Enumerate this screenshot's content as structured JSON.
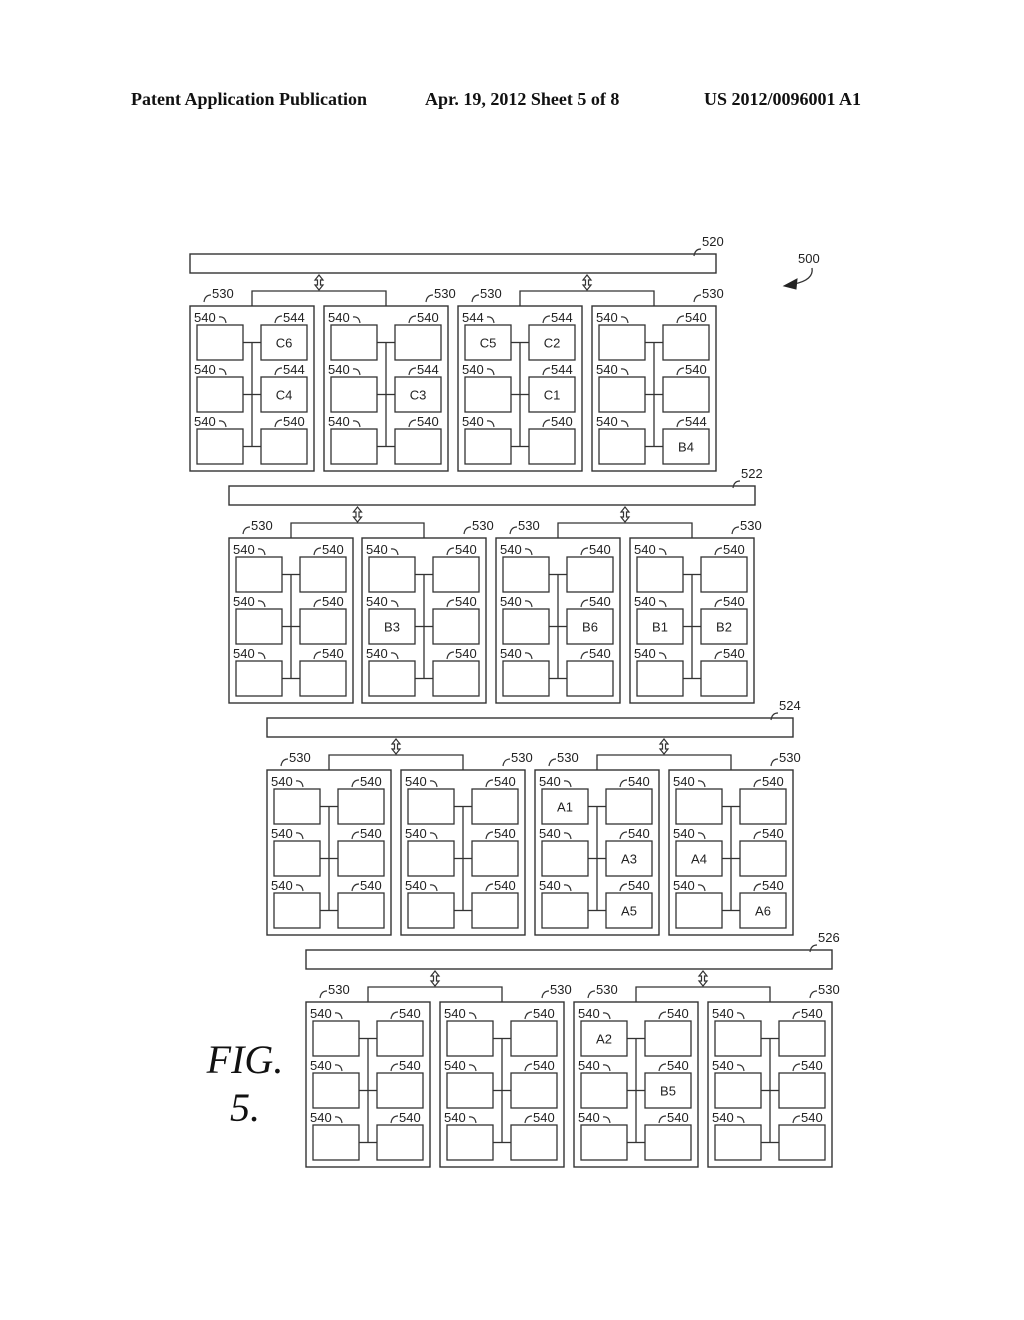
{
  "header": {
    "left": "Patent Application Publication",
    "center": "Apr. 19, 2012  Sheet 5 of 8",
    "right": "US 2012/0096001 A1"
  },
  "figure": {
    "line1": "FIG.",
    "line2": "5.",
    "system_ref": "500"
  },
  "tiers": [
    {
      "bar_ref": "520",
      "pod_ref": "530",
      "pods": [
        {
          "cells": [
            {
              "ref": "540",
              "text": ""
            },
            {
              "ref": "544",
              "text": "C6"
            },
            {
              "ref": "540",
              "text": ""
            },
            {
              "ref": "544",
              "text": "C4"
            },
            {
              "ref": "540",
              "text": ""
            },
            {
              "ref": "540",
              "text": ""
            }
          ]
        },
        {
          "cells": [
            {
              "ref": "540",
              "text": ""
            },
            {
              "ref": "540",
              "text": ""
            },
            {
              "ref": "540",
              "text": ""
            },
            {
              "ref": "544",
              "text": "C3"
            },
            {
              "ref": "540",
              "text": ""
            },
            {
              "ref": "540",
              "text": ""
            }
          ]
        },
        {
          "cells": [
            {
              "ref": "544",
              "text": "C5"
            },
            {
              "ref": "544",
              "text": "C2"
            },
            {
              "ref": "540",
              "text": ""
            },
            {
              "ref": "544",
              "text": "C1"
            },
            {
              "ref": "540",
              "text": ""
            },
            {
              "ref": "540",
              "text": ""
            }
          ]
        },
        {
          "cells": [
            {
              "ref": "540",
              "text": ""
            },
            {
              "ref": "540",
              "text": ""
            },
            {
              "ref": "540",
              "text": ""
            },
            {
              "ref": "540",
              "text": ""
            },
            {
              "ref": "540",
              "text": ""
            },
            {
              "ref": "544",
              "text": "B4"
            }
          ]
        }
      ]
    },
    {
      "bar_ref": "522",
      "pod_ref": "530",
      "pods": [
        {
          "cells": [
            {
              "ref": "540",
              "text": ""
            },
            {
              "ref": "540",
              "text": ""
            },
            {
              "ref": "540",
              "text": ""
            },
            {
              "ref": "540",
              "text": ""
            },
            {
              "ref": "540",
              "text": ""
            },
            {
              "ref": "540",
              "text": ""
            }
          ]
        },
        {
          "cells": [
            {
              "ref": "540",
              "text": ""
            },
            {
              "ref": "540",
              "text": ""
            },
            {
              "ref": "540",
              "text": "B3"
            },
            {
              "ref": "540",
              "text": ""
            },
            {
              "ref": "540",
              "text": ""
            },
            {
              "ref": "540",
              "text": ""
            }
          ]
        },
        {
          "cells": [
            {
              "ref": "540",
              "text": ""
            },
            {
              "ref": "540",
              "text": ""
            },
            {
              "ref": "540",
              "text": ""
            },
            {
              "ref": "540",
              "text": "B6"
            },
            {
              "ref": "540",
              "text": ""
            },
            {
              "ref": "540",
              "text": ""
            }
          ]
        },
        {
          "cells": [
            {
              "ref": "540",
              "text": ""
            },
            {
              "ref": "540",
              "text": ""
            },
            {
              "ref": "540",
              "text": "B1"
            },
            {
              "ref": "540",
              "text": "B2"
            },
            {
              "ref": "540",
              "text": ""
            },
            {
              "ref": "540",
              "text": ""
            }
          ]
        }
      ]
    },
    {
      "bar_ref": "524",
      "pod_ref": "530",
      "pods": [
        {
          "cells": [
            {
              "ref": "540",
              "text": ""
            },
            {
              "ref": "540",
              "text": ""
            },
            {
              "ref": "540",
              "text": ""
            },
            {
              "ref": "540",
              "text": ""
            },
            {
              "ref": "540",
              "text": ""
            },
            {
              "ref": "540",
              "text": ""
            }
          ]
        },
        {
          "cells": [
            {
              "ref": "540",
              "text": ""
            },
            {
              "ref": "540",
              "text": ""
            },
            {
              "ref": "540",
              "text": ""
            },
            {
              "ref": "540",
              "text": ""
            },
            {
              "ref": "540",
              "text": ""
            },
            {
              "ref": "540",
              "text": ""
            }
          ]
        },
        {
          "cells": [
            {
              "ref": "540",
              "text": "A1"
            },
            {
              "ref": "540",
              "text": ""
            },
            {
              "ref": "540",
              "text": ""
            },
            {
              "ref": "540",
              "text": "A3"
            },
            {
              "ref": "540",
              "text": ""
            },
            {
              "ref": "540",
              "text": "A5"
            }
          ]
        },
        {
          "cells": [
            {
              "ref": "540",
              "text": ""
            },
            {
              "ref": "540",
              "text": ""
            },
            {
              "ref": "540",
              "text": "A4"
            },
            {
              "ref": "540",
              "text": ""
            },
            {
              "ref": "540",
              "text": ""
            },
            {
              "ref": "540",
              "text": "A6"
            }
          ]
        }
      ]
    },
    {
      "bar_ref": "526",
      "pod_ref": "530",
      "pods": [
        {
          "cells": [
            {
              "ref": "540",
              "text": ""
            },
            {
              "ref": "540",
              "text": ""
            },
            {
              "ref": "540",
              "text": ""
            },
            {
              "ref": "540",
              "text": ""
            },
            {
              "ref": "540",
              "text": ""
            },
            {
              "ref": "540",
              "text": ""
            }
          ]
        },
        {
          "cells": [
            {
              "ref": "540",
              "text": ""
            },
            {
              "ref": "540",
              "text": ""
            },
            {
              "ref": "540",
              "text": ""
            },
            {
              "ref": "540",
              "text": ""
            },
            {
              "ref": "540",
              "text": ""
            },
            {
              "ref": "540",
              "text": ""
            }
          ]
        },
        {
          "cells": [
            {
              "ref": "540",
              "text": "A2"
            },
            {
              "ref": "540",
              "text": ""
            },
            {
              "ref": "540",
              "text": ""
            },
            {
              "ref": "540",
              "text": "B5"
            },
            {
              "ref": "540",
              "text": ""
            },
            {
              "ref": "540",
              "text": ""
            }
          ]
        },
        {
          "cells": [
            {
              "ref": "540",
              "text": ""
            },
            {
              "ref": "540",
              "text": ""
            },
            {
              "ref": "540",
              "text": ""
            },
            {
              "ref": "540",
              "text": ""
            },
            {
              "ref": "540",
              "text": ""
            },
            {
              "ref": "540",
              "text": ""
            }
          ]
        }
      ]
    }
  ]
}
